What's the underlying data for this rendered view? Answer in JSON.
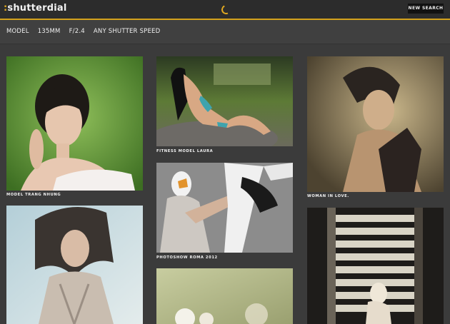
{
  "header": {
    "logo_colon": ":",
    "logo_text": "shutterdial",
    "new_search_label": "NEW SEARCH"
  },
  "filters": [
    "MODEL",
    "135MM",
    "F/2.4",
    "ANY SHUTTER SPEED"
  ],
  "photos": [
    {
      "caption": "MODEL TRANG NHUNG"
    },
    {
      "caption": "FITNESS MODEL LAURA"
    },
    {
      "caption": "PHOTOSHOW ROMA 2012"
    },
    {
      "caption": "WOMAN IN LOVE."
    },
    {
      "caption": ""
    },
    {
      "caption": ""
    },
    {
      "caption": ""
    }
  ],
  "colors": {
    "accent": "#d4a21c",
    "topbar": "#2c2c2c",
    "background": "#3b3b3b"
  }
}
